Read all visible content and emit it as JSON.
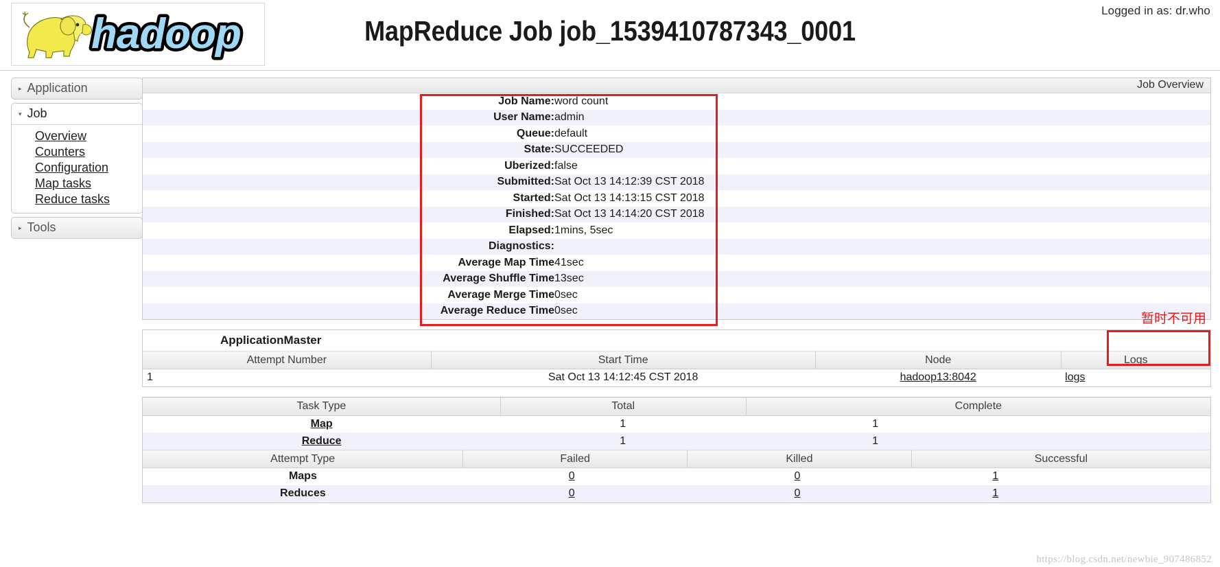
{
  "header": {
    "logged_in_label": "Logged in as: dr.who",
    "title": "MapReduce Job job_1539410787343_0001",
    "logo_alt": "hadoop-logo"
  },
  "sidebar": {
    "sections": [
      {
        "label": "Application",
        "expanded": false,
        "icon": "chevron-right-icon",
        "items": []
      },
      {
        "label": "Job",
        "expanded": true,
        "icon": "chevron-down-icon",
        "items": [
          "Overview",
          "Counters",
          "Configuration",
          "Map tasks",
          "Reduce tasks"
        ]
      },
      {
        "label": "Tools",
        "expanded": false,
        "icon": "chevron-right-icon",
        "items": []
      }
    ]
  },
  "overview": {
    "panel_title": "Job Overview",
    "rows": [
      {
        "key": "Job Name:",
        "value": "word count"
      },
      {
        "key": "User Name:",
        "value": "admin"
      },
      {
        "key": "Queue:",
        "value": "default"
      },
      {
        "key": "State:",
        "value": "SUCCEEDED"
      },
      {
        "key": "Uberized:",
        "value": "false"
      },
      {
        "key": "Submitted:",
        "value": "Sat Oct 13 14:12:39 CST 2018"
      },
      {
        "key": "Started:",
        "value": "Sat Oct 13 14:13:15 CST 2018"
      },
      {
        "key": "Finished:",
        "value": "Sat Oct 13 14:14:20 CST 2018"
      },
      {
        "key": "Elapsed:",
        "value": "1mins, 5sec"
      },
      {
        "key": "Diagnostics:",
        "value": ""
      },
      {
        "key": "Average Map Time",
        "value": "41sec"
      },
      {
        "key": "Average Shuffle Time",
        "value": "13sec"
      },
      {
        "key": "Average Merge Time",
        "value": "0sec"
      },
      {
        "key": "Average Reduce Time",
        "value": "0sec"
      }
    ]
  },
  "annotation": {
    "text": "暂时不可用",
    "color": "#e81c1c"
  },
  "application_master": {
    "caption": "ApplicationMaster",
    "columns": [
      "Attempt Number",
      "Start Time",
      "Node",
      "Logs"
    ],
    "rows": [
      {
        "attempt_number": "1",
        "start_time": "Sat Oct 13 14:12:45 CST 2018",
        "node": "hadoop13:8042",
        "logs": "logs"
      }
    ]
  },
  "task_summary": {
    "columns": [
      "Task Type",
      "Total",
      "Complete"
    ],
    "rows": [
      {
        "task_type": "Map",
        "total": "1",
        "complete": "1"
      },
      {
        "task_type": "Reduce",
        "total": "1",
        "complete": "1"
      }
    ]
  },
  "attempt_summary": {
    "columns": [
      "Attempt Type",
      "Failed",
      "Killed",
      "Successful"
    ],
    "rows": [
      {
        "attempt_type": "Maps",
        "failed": "0",
        "killed": "0",
        "successful": "1"
      },
      {
        "attempt_type": "Reduces",
        "failed": "0",
        "killed": "0",
        "successful": "1"
      }
    ]
  },
  "watermark": {
    "text": "https://blog.csdn.net/newbie_907486852"
  },
  "colors": {
    "highlight_border": "#e81c1c",
    "alt_row": "#f1f1fb",
    "logo_yellow": "#f2ea4c",
    "logo_blue": "#9fd8f4"
  }
}
